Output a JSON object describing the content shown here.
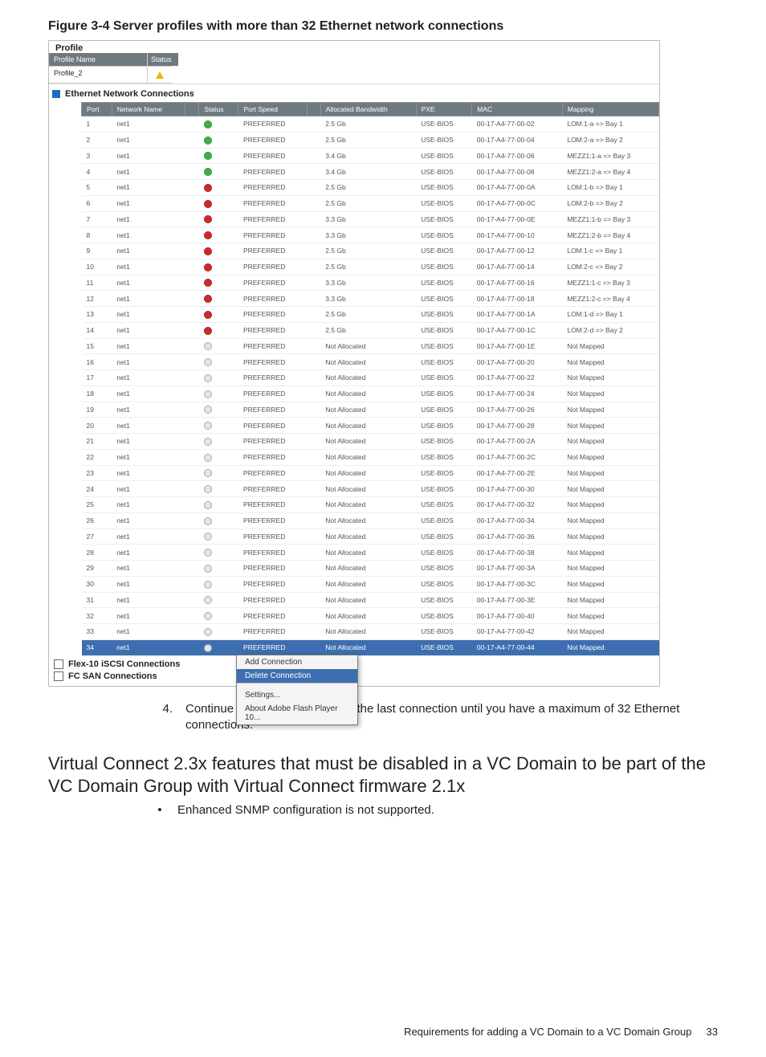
{
  "figure_title": "Figure 3-4 Server profiles with more than 32 Ethernet network connections",
  "profile": {
    "card_title": "Profile",
    "name_header": "Profile Name",
    "status_header": "Status",
    "name_value": "Profile_2"
  },
  "section_ethernet": "Ethernet Network Connections",
  "section_iscsi": "Flex-10 iSCSI Connections",
  "section_fc": "FC SAN Connections",
  "columns": [
    "Port",
    "Network Name",
    "",
    "Status",
    "Port Speed",
    "",
    "Allocated Bandwidth",
    "PXE",
    "MAC",
    "Mapping"
  ],
  "rows": [
    {
      "port": "1",
      "net": "net1",
      "status": "green",
      "speed": "PREFERRED",
      "bw": "2.5 Gb",
      "pxe": "USE-BIOS",
      "mac": "00-17-A4-77-00-02",
      "map": "LOM:1-a => Bay 1"
    },
    {
      "port": "2",
      "net": "net1",
      "status": "green",
      "speed": "PREFERRED",
      "bw": "2.5 Gb",
      "pxe": "USE-BIOS",
      "mac": "00-17-A4-77-00-04",
      "map": "LOM:2-a => Bay 2"
    },
    {
      "port": "3",
      "net": "net1",
      "status": "green",
      "speed": "PREFERRED",
      "bw": "3.4 Gb",
      "pxe": "USE-BIOS",
      "mac": "00-17-A4-77-00-06",
      "map": "MEZZ1:1-a => Bay 3"
    },
    {
      "port": "4",
      "net": "net1",
      "status": "green",
      "speed": "PREFERRED",
      "bw": "3.4 Gb",
      "pxe": "USE-BIOS",
      "mac": "00-17-A4-77-00-08",
      "map": "MEZZ1:2-a => Bay 4"
    },
    {
      "port": "5",
      "net": "net1",
      "status": "red",
      "speed": "PREFERRED",
      "bw": "2.5 Gb",
      "pxe": "USE-BIOS",
      "mac": "00-17-A4-77-00-0A",
      "map": "LOM:1-b => Bay 1"
    },
    {
      "port": "6",
      "net": "net1",
      "status": "red",
      "speed": "PREFERRED",
      "bw": "2.5 Gb",
      "pxe": "USE-BIOS",
      "mac": "00-17-A4-77-00-0C",
      "map": "LOM:2-b => Bay 2"
    },
    {
      "port": "7",
      "net": "net1",
      "status": "red",
      "speed": "PREFERRED",
      "bw": "3.3 Gb",
      "pxe": "USE-BIOS",
      "mac": "00-17-A4-77-00-0E",
      "map": "MEZZ1:1-b => Bay 3"
    },
    {
      "port": "8",
      "net": "net1",
      "status": "red",
      "speed": "PREFERRED",
      "bw": "3.3 Gb",
      "pxe": "USE-BIOS",
      "mac": "00-17-A4-77-00-10",
      "map": "MEZZ1:2-b => Bay 4"
    },
    {
      "port": "9",
      "net": "net1",
      "status": "red",
      "speed": "PREFERRED",
      "bw": "2.5 Gb",
      "pxe": "USE-BIOS",
      "mac": "00-17-A4-77-00-12",
      "map": "LOM:1-c => Bay 1"
    },
    {
      "port": "10",
      "net": "net1",
      "status": "red",
      "speed": "PREFERRED",
      "bw": "2.5 Gb",
      "pxe": "USE-BIOS",
      "mac": "00-17-A4-77-00-14",
      "map": "LOM:2-c => Bay 2"
    },
    {
      "port": "11",
      "net": "net1",
      "status": "red",
      "speed": "PREFERRED",
      "bw": "3.3 Gb",
      "pxe": "USE-BIOS",
      "mac": "00-17-A4-77-00-16",
      "map": "MEZZ1:1-c => Bay 3"
    },
    {
      "port": "12",
      "net": "net1",
      "status": "red",
      "speed": "PREFERRED",
      "bw": "3.3 Gb",
      "pxe": "USE-BIOS",
      "mac": "00-17-A4-77-00-18",
      "map": "MEZZ1:2-c => Bay 4"
    },
    {
      "port": "13",
      "net": "net1",
      "status": "red",
      "speed": "PREFERRED",
      "bw": "2.5 Gb",
      "pxe": "USE-BIOS",
      "mac": "00-17-A4-77-00-1A",
      "map": "LOM:1-d => Bay 1"
    },
    {
      "port": "14",
      "net": "net1",
      "status": "red",
      "speed": "PREFERRED",
      "bw": "2.5 Gb",
      "pxe": "USE-BIOS",
      "mac": "00-17-A4-77-00-1C",
      "map": "LOM:2-d => Bay 2"
    },
    {
      "port": "15",
      "net": "net1",
      "status": "grey",
      "speed": "PREFERRED",
      "bw": "Not Allocated",
      "pxe": "USE-BIOS",
      "mac": "00-17-A4-77-00-1E",
      "map": "Not Mapped"
    },
    {
      "port": "16",
      "net": "net1",
      "status": "grey",
      "speed": "PREFERRED",
      "bw": "Not Allocated",
      "pxe": "USE-BIOS",
      "mac": "00-17-A4-77-00-20",
      "map": "Not Mapped"
    },
    {
      "port": "17",
      "net": "net1",
      "status": "grey",
      "speed": "PREFERRED",
      "bw": "Not Allocated",
      "pxe": "USE-BIOS",
      "mac": "00-17-A4-77-00-22",
      "map": "Not Mapped"
    },
    {
      "port": "18",
      "net": "net1",
      "status": "grey",
      "speed": "PREFERRED",
      "bw": "Not Allocated",
      "pxe": "USE-BIOS",
      "mac": "00-17-A4-77-00-24",
      "map": "Not Mapped"
    },
    {
      "port": "19",
      "net": "net1",
      "status": "grey",
      "speed": "PREFERRED",
      "bw": "Not Allocated",
      "pxe": "USE-BIOS",
      "mac": "00-17-A4-77-00-26",
      "map": "Not Mapped"
    },
    {
      "port": "20",
      "net": "net1",
      "status": "grey",
      "speed": "PREFERRED",
      "bw": "Not Allocated",
      "pxe": "USE-BIOS",
      "mac": "00-17-A4-77-00-28",
      "map": "Not Mapped"
    },
    {
      "port": "21",
      "net": "net1",
      "status": "grey",
      "speed": "PREFERRED",
      "bw": "Not Allocated",
      "pxe": "USE-BIOS",
      "mac": "00-17-A4-77-00-2A",
      "map": "Not Mapped"
    },
    {
      "port": "22",
      "net": "net1",
      "status": "grey",
      "speed": "PREFERRED",
      "bw": "Not Allocated",
      "pxe": "USE-BIOS",
      "mac": "00-17-A4-77-00-2C",
      "map": "Not Mapped"
    },
    {
      "port": "23",
      "net": "net1",
      "status": "grey",
      "speed": "PREFERRED",
      "bw": "Not Allocated",
      "pxe": "USE-BIOS",
      "mac": "00-17-A4-77-00-2E",
      "map": "Not Mapped"
    },
    {
      "port": "24",
      "net": "net1",
      "status": "grey",
      "speed": "PREFERRED",
      "bw": "Not Allocated",
      "pxe": "USE-BIOS",
      "mac": "00-17-A4-77-00-30",
      "map": "Not Mapped"
    },
    {
      "port": "25",
      "net": "net1",
      "status": "grey",
      "speed": "PREFERRED",
      "bw": "Not Allocated",
      "pxe": "USE-BIOS",
      "mac": "00-17-A4-77-00-32",
      "map": "Not Mapped"
    },
    {
      "port": "26",
      "net": "net1",
      "status": "grey",
      "speed": "PREFERRED",
      "bw": "Not Allocated",
      "pxe": "USE-BIOS",
      "mac": "00-17-A4-77-00-34",
      "map": "Not Mapped"
    },
    {
      "port": "27",
      "net": "net1",
      "status": "grey",
      "speed": "PREFERRED",
      "bw": "Not Allocated",
      "pxe": "USE-BIOS",
      "mac": "00-17-A4-77-00-36",
      "map": "Not Mapped"
    },
    {
      "port": "28",
      "net": "net1",
      "status": "grey",
      "speed": "PREFERRED",
      "bw": "Not Allocated",
      "pxe": "USE-BIOS",
      "mac": "00-17-A4-77-00-38",
      "map": "Not Mapped"
    },
    {
      "port": "29",
      "net": "net1",
      "status": "grey",
      "speed": "PREFERRED",
      "bw": "Not Allocated",
      "pxe": "USE-BIOS",
      "mac": "00-17-A4-77-00-3A",
      "map": "Not Mapped"
    },
    {
      "port": "30",
      "net": "net1",
      "status": "grey",
      "speed": "PREFERRED",
      "bw": "Not Allocated",
      "pxe": "USE-BIOS",
      "mac": "00-17-A4-77-00-3C",
      "map": "Not Mapped"
    },
    {
      "port": "31",
      "net": "net1",
      "status": "grey",
      "speed": "PREFERRED",
      "bw": "Not Allocated",
      "pxe": "USE-BIOS",
      "mac": "00-17-A4-77-00-3E",
      "map": "Not Mapped"
    },
    {
      "port": "32",
      "net": "net1",
      "status": "grey",
      "speed": "PREFERRED",
      "bw": "Not Allocated",
      "pxe": "USE-BIOS",
      "mac": "00-17-A4-77-00-40",
      "map": "Not Mapped"
    },
    {
      "port": "33",
      "net": "net1",
      "status": "grey",
      "speed": "PREFERRED",
      "bw": "Not Allocated",
      "pxe": "USE-BIOS",
      "mac": "00-17-A4-77-00-42",
      "map": "Not Mapped"
    },
    {
      "port": "34",
      "net": "net1",
      "status": "grey",
      "speed": "PREFERRED",
      "bw": "Not Allocated",
      "pxe": "USE-BIOS",
      "mac": "00-17-A4-77-00-44",
      "map": "Not Mapped",
      "selected": true
    }
  ],
  "context_menu": {
    "add": "Add Connection",
    "delete": "Delete Connection",
    "settings": "Settings...",
    "about": "About Adobe Flash Player 10..."
  },
  "step": {
    "num": "4.",
    "text": "Continue selecting and deleting the last connection until you have a maximum of 32 Ethernet connections."
  },
  "heading": "Virtual Connect 2.3x features that must be disabled in a VC Domain to be part of the VC Domain Group with Virtual Connect firmware 2.1x",
  "bullet1": "Enhanced SNMP configuration is not supported.",
  "footer_text": "Requirements for adding a VC Domain to a VC Domain Group",
  "footer_page": "33"
}
